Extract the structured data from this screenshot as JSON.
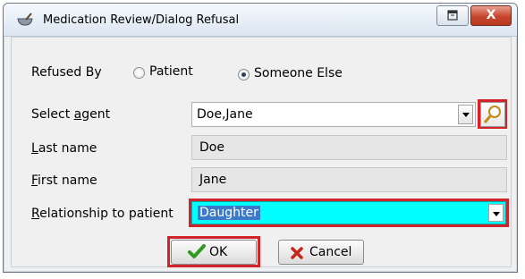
{
  "window": {
    "title": "Medication Review/Dialog Refusal",
    "app_icon": "mortar-pestle-icon",
    "restore_icon": "restore-icon",
    "close_icon": "close-icon",
    "close_glyph": "X"
  },
  "refused_by": {
    "label": "Refused By",
    "options": [
      {
        "label": "Patient",
        "selected": false
      },
      {
        "label": "Someone Else",
        "selected": true
      }
    ]
  },
  "select_agent": {
    "label_prefix": "Select ",
    "label_hotkey": "a",
    "label_suffix": "gent",
    "value": "Doe,Jane",
    "search_icon": "magnifier-icon"
  },
  "last_name": {
    "label_hotkey": "L",
    "label_rest": "ast name",
    "value": "Doe"
  },
  "first_name": {
    "label_hotkey": "F",
    "label_rest": "irst name",
    "value": "Jane"
  },
  "relationship": {
    "label_hotkey": "R",
    "label_rest": "elationship to patient",
    "value": "Daughter",
    "highlight_color": "#00ffff"
  },
  "buttons": {
    "ok_label": "OK",
    "ok_icon": "checkmark-icon",
    "cancel_label": "Cancel",
    "cancel_icon": "x-mark-icon"
  },
  "colors": {
    "highlight_border": "#d2232a",
    "selection_blue": "#3b79c9",
    "check_green": "#2e9a1e",
    "cancel_red": "#c8251b"
  }
}
